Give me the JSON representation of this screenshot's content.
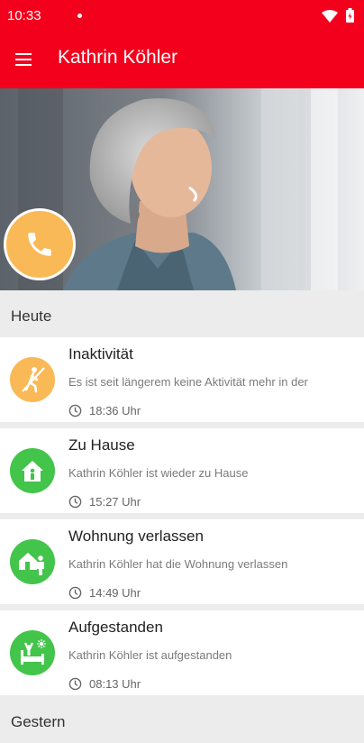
{
  "status_bar": {
    "time": "10:33"
  },
  "app_bar": {
    "title": "Kathrin Köhler",
    "menu_icon": "hamburger-menu-icon"
  },
  "hero": {
    "call_icon": "phone-icon",
    "call_color": "#f9b956"
  },
  "sections": [
    {
      "title": "Heute"
    },
    {
      "title": "Gestern"
    }
  ],
  "events": [
    {
      "title": "Inaktivität",
      "text": "Es ist seit längerem keine Aktivität mehr in der",
      "time": "18:36 Uhr",
      "icon": "inactivity-icon",
      "color": "#f9b956"
    },
    {
      "title": "Zu Hause",
      "text": "Kathrin Köhler ist wieder zu Hause",
      "time": "15:27 Uhr",
      "icon": "home-icon",
      "color": "#43c44a"
    },
    {
      "title": "Wohnung verlassen",
      "text": "Kathrin Köhler hat die Wohnung verlassen",
      "time": "14:49 Uhr",
      "icon": "left-home-icon",
      "color": "#43c44a"
    },
    {
      "title": "Aufgestanden",
      "text": "Kathrin Köhler ist aufgestanden",
      "time": "08:13 Uhr",
      "icon": "got-up-icon",
      "color": "#43c44a"
    }
  ],
  "colors": {
    "brand": "#f2001c",
    "accent": "#f9b956",
    "ok": "#43c44a"
  }
}
